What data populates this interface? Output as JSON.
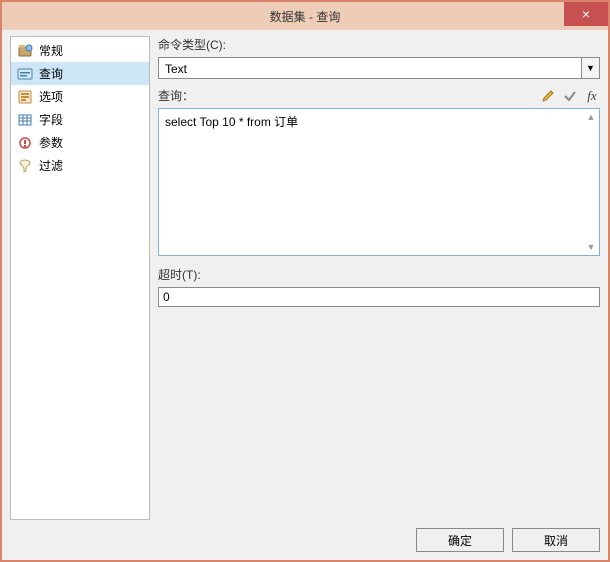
{
  "window": {
    "title": "数据集 - 查询",
    "close": "×"
  },
  "sidebar": {
    "items": [
      {
        "label": "常规"
      },
      {
        "label": "查询"
      },
      {
        "label": "选项"
      },
      {
        "label": "字段"
      },
      {
        "label": "参数"
      },
      {
        "label": "过滤"
      }
    ],
    "selected_index": 1
  },
  "content": {
    "command_type_label": "命令类型(C):",
    "command_type_value": "Text",
    "query_label": "查询：",
    "query_value": "select Top 10 * from 订单",
    "timeout_label": "超时(T):",
    "timeout_value": "0"
  },
  "icons": {
    "dropdown": "▼",
    "scroll_up": "▲",
    "scroll_down": "▼"
  },
  "footer": {
    "ok": "确定",
    "cancel": "取消"
  }
}
